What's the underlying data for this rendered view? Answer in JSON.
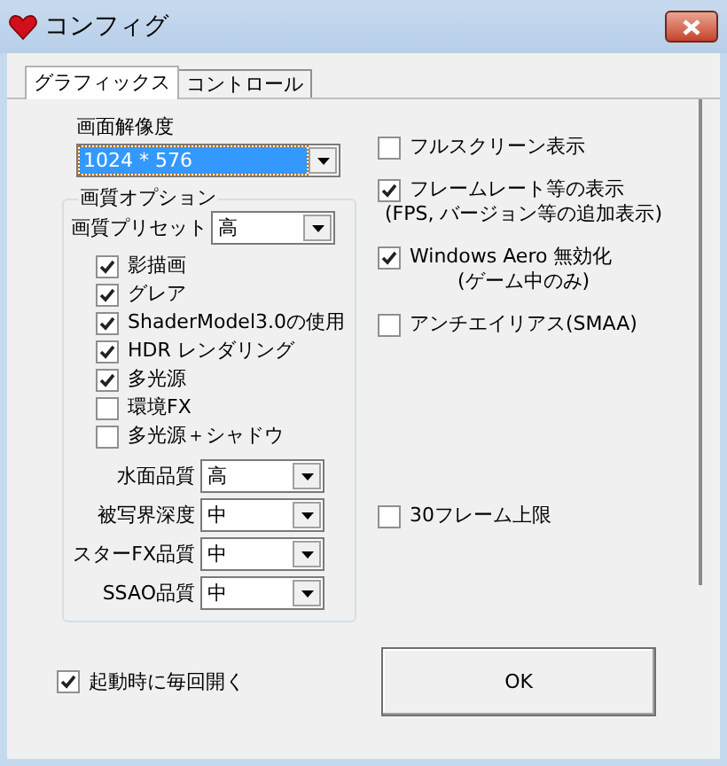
{
  "window": {
    "title": "コンフィグ"
  },
  "tabs": [
    {
      "label": "グラフィックス",
      "selected": true
    },
    {
      "label": "コントロール",
      "selected": false
    }
  ],
  "resolution": {
    "label": "画面解像度",
    "value": "1024 * 576"
  },
  "quality_group": {
    "title": "画質オプション",
    "preset": {
      "label": "画質プリセット",
      "value": "高"
    },
    "checkboxes": [
      {
        "label": "影描画",
        "checked": true
      },
      {
        "label": "グレア",
        "checked": true
      },
      {
        "label": "ShaderModel3.0の使用",
        "checked": true
      },
      {
        "label": "HDR レンダリング",
        "checked": true
      },
      {
        "label": "多光源",
        "checked": true
      },
      {
        "label": "環境FX",
        "checked": false
      },
      {
        "label": "多光源＋シャドウ",
        "checked": false
      }
    ],
    "selects": [
      {
        "label": "水面品質",
        "value": "高"
      },
      {
        "label": "被写界深度",
        "value": "中"
      },
      {
        "label": "スターFX品質",
        "value": "中"
      },
      {
        "label": "SSAO品質",
        "value": "中"
      }
    ]
  },
  "right_options": [
    {
      "label": "フルスクリーン表示",
      "checked": false
    },
    {
      "label": "フレームレート等の表示",
      "note": "(FPS, バージョン等の追加表示)",
      "checked": true
    },
    {
      "label": "Windows Aero 無効化",
      "note": "(ゲーム中のみ)",
      "checked": true
    },
    {
      "label": "アンチエイリアス(SMAA)",
      "checked": false
    }
  ],
  "frame_limit": {
    "label": "30フレーム上限",
    "checked": false
  },
  "startup": {
    "label": "起動時に毎回開く",
    "checked": true
  },
  "ok_button": "OK"
}
